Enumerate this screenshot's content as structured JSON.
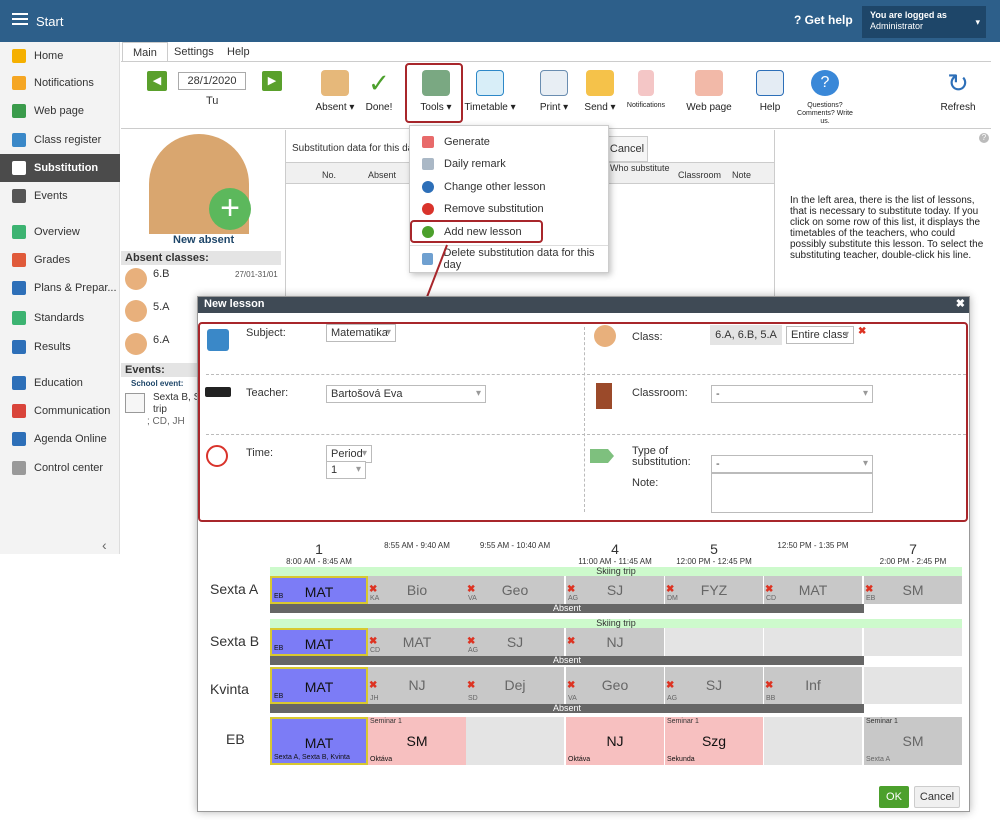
{
  "topbar": {
    "title": "Start",
    "help": "Get help",
    "logged_as": "You are logged as",
    "user": "Administrator"
  },
  "sidebar": {
    "items": [
      {
        "label": "Home",
        "color": "#f5b000"
      },
      {
        "label": "Notifications",
        "color": "#f5a623"
      },
      {
        "label": "Web page",
        "color": "#3a9b4b"
      },
      {
        "label": "Class register",
        "color": "#3a88c8"
      },
      {
        "label": "Substitution",
        "color": "#ffffff"
      },
      {
        "label": "Events",
        "color": "#555555"
      },
      {
        "label": "Overview",
        "color": "#3cb371"
      },
      {
        "label": "Grades",
        "color": "#e05a3a"
      },
      {
        "label": "Plans & Prepar...",
        "color": "#2d6fb8"
      },
      {
        "label": "Standards",
        "color": "#3cb371"
      },
      {
        "label": "Results",
        "color": "#2d6fb8"
      },
      {
        "label": "Education",
        "color": "#2d6fb8"
      },
      {
        "label": "Communication",
        "color": "#d9443a"
      },
      {
        "label": "Agenda Online",
        "color": "#2d6fb8"
      },
      {
        "label": "Control center",
        "color": "#999999"
      }
    ]
  },
  "tabs": [
    "Main",
    "Settings",
    "Help"
  ],
  "ribbon": {
    "date": "28/1/2020",
    "day": "Tu",
    "buttons": [
      "Absent",
      "Done!",
      "Tools",
      "Timetable",
      "Print",
      "Send",
      "Notifications",
      "Web page",
      "Help",
      "Questions? Comments? Write us.",
      "Refresh"
    ]
  },
  "left_panel": {
    "new_absent": "New absent",
    "absent_classes_title": "Absent classes:",
    "classes": [
      {
        "name": "6.B",
        "date": "27/01-31/01"
      },
      {
        "name": "5.A",
        "date": ""
      },
      {
        "name": "6.A",
        "date": ""
      }
    ],
    "events_title": "Events:",
    "school_event": "School event:",
    "event_text": "Sexta B, S",
    "event_text2": "trip",
    "event_text3": "; CD, JH"
  },
  "center": {
    "title": "Substitution data for this da",
    "cancel": "Cancel",
    "cols": [
      "No.",
      "Absent",
      "Who substitute",
      "Classroom",
      "Note"
    ]
  },
  "right_info": "In the left area, there is the list of lessons, that is necessary to substitute today. If you click on some row of this list, it displays the timetables of the teachers, who could possibly substitute this lesson. To select the substituting teacher, double-click his line.",
  "dropdown": {
    "items": [
      "Generate",
      "Daily remark",
      "Change other lesson",
      "Remove substitution",
      "Add new lesson",
      "Delete substitution data for this day"
    ]
  },
  "modal": {
    "title": "New lesson",
    "subject_label": "Subject:",
    "subject_value": "Matematika",
    "class_label": "Class:",
    "class_value": "6.A, 6.B, 5.A",
    "class_group": "Entire class",
    "teacher_label": "Teacher:",
    "teacher_value": "Bartošová Eva",
    "classroom_label": "Classroom:",
    "classroom_value": "-",
    "time_label": "Time:",
    "time_mode": "Period",
    "period": "1",
    "type_label": "Type of substitution:",
    "type_value": "-",
    "note_label": "Note:",
    "ok": "OK",
    "cancel": "Cancel"
  },
  "timetable": {
    "periods": [
      {
        "num": "1",
        "time": "8:00 AM - 8:45 AM"
      },
      {
        "num": "",
        "time": "8:55 AM - 9:40 AM"
      },
      {
        "num": "",
        "time": "9:55 AM - 10:40 AM"
      },
      {
        "num": "4",
        "time": "11:00 AM - 11:45 AM"
      },
      {
        "num": "5",
        "time": "12:00 PM - 12:45 PM"
      },
      {
        "num": "",
        "time": "12:50 PM - 1:35 PM"
      },
      {
        "num": "7",
        "time": "2:00 PM - 2:45 PM"
      }
    ],
    "rows": [
      {
        "label": "Sexta A",
        "cells": [
          "MAT",
          "Bio",
          "Geo",
          "SJ",
          "FYZ",
          "MAT",
          "SM"
        ],
        "subs": [
          "EB",
          "KA",
          "VA",
          "AG",
          "DM",
          "CD",
          "EB"
        ],
        "banner": "Skiing trip",
        "absent": "Absent"
      },
      {
        "label": "Sexta B",
        "cells": [
          "MAT",
          "MAT",
          "SJ",
          "NJ",
          "",
          "",
          ""
        ],
        "subs": [
          "EB",
          "CD",
          "AG",
          "",
          "",
          "",
          ""
        ],
        "banner": "Skiing trip",
        "absent": "Absent"
      },
      {
        "label": "Kvinta",
        "cells": [
          "MAT",
          "NJ",
          "Dej",
          "Geo",
          "SJ",
          "Inf",
          ""
        ],
        "subs": [
          "EB",
          "JH",
          "SD",
          "VA",
          "AG",
          "BB",
          ""
        ],
        "banner": "",
        "absent": "Absent"
      },
      {
        "label": "EB",
        "cells": [
          "MAT",
          "SM",
          "",
          "NJ",
          "Szg",
          "",
          "SM"
        ],
        "subs": [
          "Sexta A, Sexta B, Kvinta",
          "Oktáva",
          "",
          "Oktáva",
          "Sekunda",
          "",
          "Sexta A"
        ],
        "tops": [
          "",
          "Seminar 1",
          "",
          "",
          "Seminar 1",
          "",
          "Seminar 1"
        ]
      }
    ],
    "small": {
      "fyz": "FYZ",
      "mat": "MAT",
      "nj": "NJ",
      "seminar": "Seminar 1"
    }
  }
}
